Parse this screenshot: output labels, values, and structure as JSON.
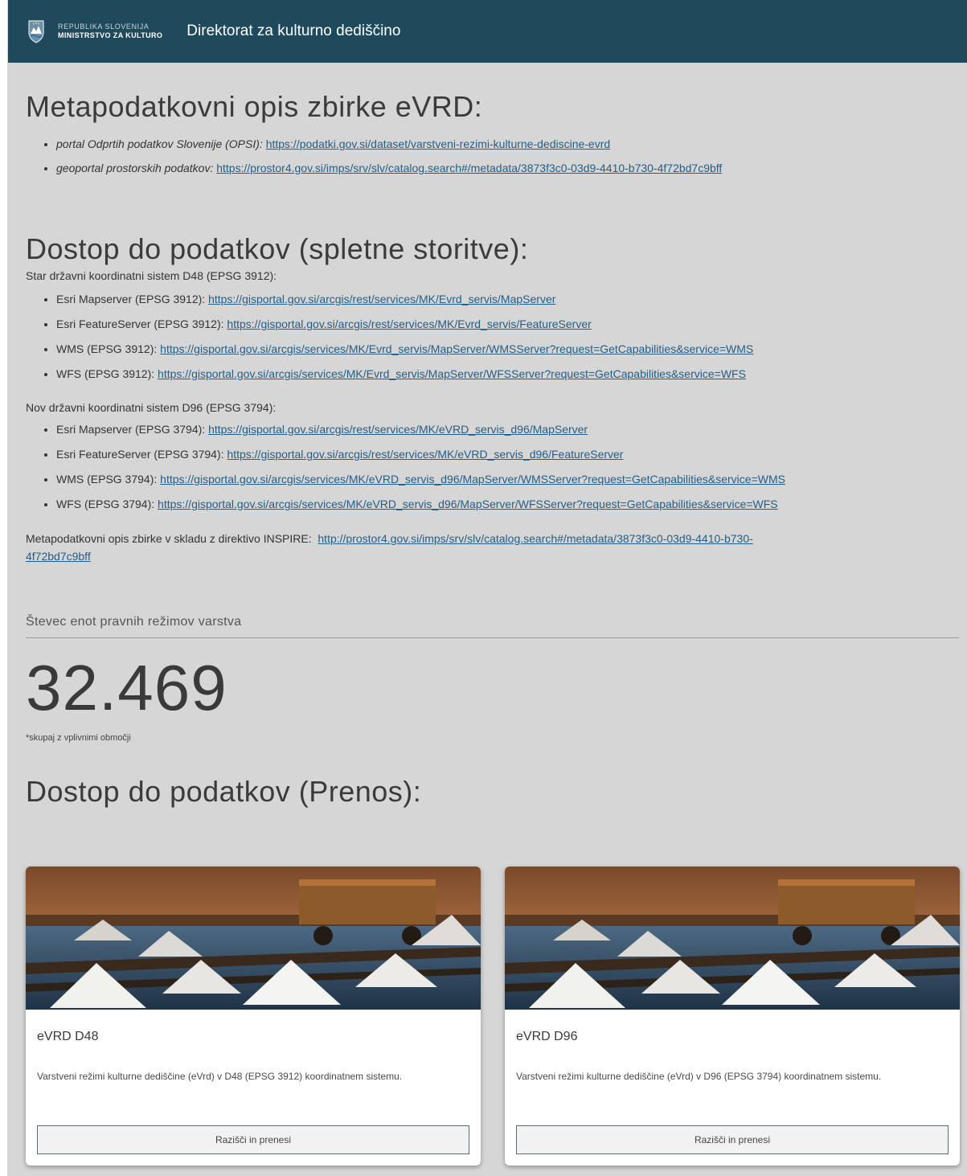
{
  "header": {
    "logo_line1": "REPUBLIKA SLOVENIJA",
    "logo_line2": "MINISTRSTVO ZA KULTURO",
    "title": "Direktorat za kulturno dediščino",
    "bg_color": "#1f4a5c"
  },
  "meta_section": {
    "heading": "Metapodatkovni opis zbirke eVRD:",
    "items": [
      {
        "label": "portal Odprtih podatkov Slovenije (OPSI):",
        "link": "https://podatki.gov.si/dataset/varstveni-rezimi-kulturne-dediscine-evrd"
      },
      {
        "label": "geoportal prostorskih podatkov:",
        "link": "https://prostor4.gov.si/imps/srv/slv/catalog.search#/metadata/3873f3c0-03d9-4410-b730-4f72bd7c9bff"
      }
    ]
  },
  "services_section": {
    "heading": "Dostop do podatkov (spletne storitve):",
    "d48": {
      "subheading": "Star državni koordinatni sistem D48 (EPSG 3912):",
      "items": [
        {
          "label": "Esri Mapserver (EPSG 3912):",
          "link": "https://gisportal.gov.si/arcgis/rest/services/MK/Evrd_servis/MapServer"
        },
        {
          "label": "Esri FeatureServer (EPSG 3912):",
          "link": "https://gisportal.gov.si/arcgis/rest/services/MK/Evrd_servis/FeatureServer"
        },
        {
          "label": "WMS (EPSG 3912):",
          "link": "https://gisportal.gov.si/arcgis/services/MK/Evrd_servis/MapServer/WMSServer?request=GetCapabilities&service=WMS"
        },
        {
          "label": "WFS (EPSG 3912):",
          "link": "https://gisportal.gov.si/arcgis/services/MK/Evrd_servis/MapServer/WFSServer?request=GetCapabilities&service=WFS"
        }
      ]
    },
    "d96": {
      "subheading": "Nov državni koordinatni sistem D96 (EPSG 3794):",
      "items": [
        {
          "label": "Esri Mapserver (EPSG 3794):",
          "link": "https://gisportal.gov.si/arcgis/rest/services/MK/eVRD_servis_d96/MapServer"
        },
        {
          "label": "Esri FeatureServer (EPSG 3794):",
          "link": "https://gisportal.gov.si/arcgis/rest/services/MK/eVRD_servis_d96/FeatureServer"
        },
        {
          "label": "WMS (EPSG 3794):",
          "link": "https://gisportal.gov.si/arcgis/services/MK/eVRD_servis_d96/MapServer/WMSServer?request=GetCapabilities&service=WMS"
        },
        {
          "label": "WFS (EPSG 3794):",
          "link": "https://gisportal.gov.si/arcgis/services/MK/eVRD_servis_d96/MapServer/WFSServer?request=GetCapabilities&service=WFS"
        }
      ]
    },
    "inspire_label": "Metapodatkovni opis zbirke v skladu z direktivo INSPIRE:",
    "inspire_link_line1": "http://prostor4.gov.si/imps/srv/slv/catalog.search#/metadata/3873f3c0-03d9-4410-b730-",
    "inspire_link_line2": "4f72bd7c9bff"
  },
  "counter": {
    "title": "Števec enot pravnih režimov varstva",
    "value": "32.469",
    "note": "*skupaj z vplivnimi območji"
  },
  "download_section": {
    "heading": "Dostop do podatkov (Prenos):",
    "cards": [
      {
        "title": "eVRD D48",
        "description": "Varstveni režimi kulturne dediščine (eVrd) v D48 (EPSG 3912) koordinatnem sistemu.",
        "button": "Razišči in prenesi",
        "image_icon": "salt-pans-photo"
      },
      {
        "title": "eVRD D96",
        "description": "Varstveni režimi kulturne dediščine (eVrd) v D96 (EPSG 3794) koordinatnem sistemu.",
        "button": "Razišči in prenesi",
        "image_icon": "salt-pans-photo"
      }
    ]
  },
  "colors": {
    "page_bg": "#d6d6d6",
    "link": "#245e86"
  }
}
